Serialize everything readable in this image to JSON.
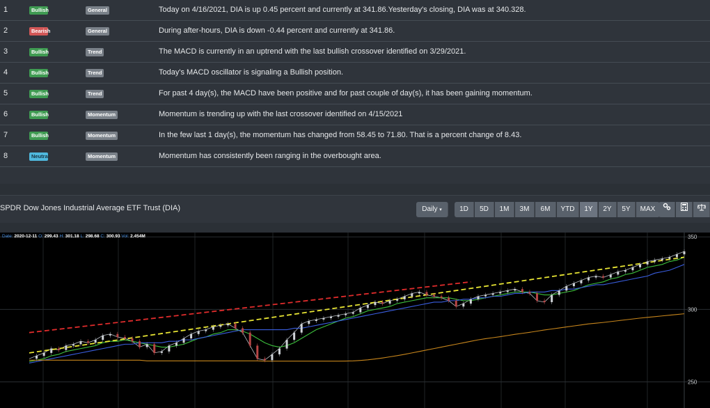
{
  "signals": [
    {
      "num": "1",
      "sentiment": "Bullish",
      "sentiment_kind": "pos",
      "category": "General",
      "text": "Today on 4/16/2021, DIA is up 0.45 percent and currently at 341.86.Yesterday's closing, DIA was at 340.328."
    },
    {
      "num": "2",
      "sentiment": "Bearish",
      "sentiment_kind": "neg",
      "category": "General",
      "text": "During after-hours, DIA is down -0.44 percent and currently at 341.86."
    },
    {
      "num": "3",
      "sentiment": "Bullish",
      "sentiment_kind": "pos",
      "category": "Trend",
      "text": "The MACD is currently in an uptrend with the last bullish crossover identified on 3/29/2021."
    },
    {
      "num": "4",
      "sentiment": "Bullish",
      "sentiment_kind": "pos",
      "category": "Trend",
      "text": "Today's MACD oscillator is signaling a Bullish position."
    },
    {
      "num": "5",
      "sentiment": "Bullish",
      "sentiment_kind": "pos",
      "category": "Trend",
      "text": "For past 4 day(s), the MACD have been positive and for past couple of day(s), it has been gaining momentum."
    },
    {
      "num": "6",
      "sentiment": "Bullish",
      "sentiment_kind": "pos",
      "category": "Momentum",
      "text": "Momentum is trending up with the last crossover identified on 4/15/2021"
    },
    {
      "num": "7",
      "sentiment": "Bullish",
      "sentiment_kind": "pos",
      "category": "Momentum",
      "text": "In the few last 1 day(s), the momentum has changed from 58.45 to 71.80. That is a percent change of 8.43."
    },
    {
      "num": "8",
      "sentiment": "Neutral",
      "sentiment_kind": "neu",
      "category": "Momentum",
      "text": "Momentum has consistently been ranging in the overbought area."
    }
  ],
  "toolbar": {
    "title": "SPDR Dow Jones Industrial Average ETF Trust (DIA)",
    "interval": "Daily",
    "ranges": [
      "1D",
      "5D",
      "1M",
      "3M",
      "6M",
      "YTD",
      "1Y",
      "2Y",
      "5Y",
      "MAX"
    ],
    "active_range": "1Y",
    "tool_icons": [
      "indicators-icon",
      "calculator-icon",
      "compare-icon"
    ]
  },
  "ohlc": {
    "date_label": "Date:",
    "date": "2020-12-11",
    "o_label": "O:",
    "o": "299.43",
    "h_label": "H:",
    "h": "301.18",
    "l_label": "L:",
    "l": "298.68",
    "c_label": "C:",
    "c": "300.93",
    "v_label": "Vol:",
    "v": "2.454M"
  },
  "chart_data": {
    "type": "line",
    "y_ticks": [
      250,
      300,
      350
    ],
    "ylim": [
      232,
      353
    ],
    "series": [
      {
        "kind": "close",
        "color": "#b9bec4",
        "values": [
          266,
          268,
          270,
          273,
          272,
          275,
          276,
          278,
          277,
          279,
          282,
          283,
          281,
          280,
          278,
          274,
          276,
          270,
          271,
          275,
          277,
          280,
          283,
          285,
          286,
          288,
          289,
          290,
          287,
          284,
          275,
          266,
          265,
          269,
          273,
          279,
          284,
          290,
          292,
          293,
          294,
          295,
          296,
          297,
          298,
          301,
          303,
          305,
          304,
          306,
          307,
          309,
          311,
          312,
          310,
          309,
          308,
          306,
          302,
          304,
          307,
          309,
          310,
          311,
          312,
          313,
          314,
          312,
          311,
          306,
          305,
          310,
          313,
          316,
          318,
          320,
          322,
          323,
          322,
          324,
          326,
          327,
          329,
          331,
          333,
          334,
          335,
          336,
          338,
          340
        ]
      },
      {
        "kind": "sma-short",
        "color": "#3cbf3c",
        "values": [
          264,
          265,
          266,
          268,
          269,
          271,
          272,
          273,
          274,
          275,
          277,
          278,
          278,
          279,
          278,
          277,
          276,
          275,
          274,
          274,
          275,
          276,
          278,
          280,
          281,
          283,
          284,
          286,
          286,
          285,
          283,
          280,
          277,
          275,
          274,
          275,
          277,
          280,
          283,
          286,
          288,
          290,
          292,
          294,
          295,
          297,
          299,
          300,
          301,
          302,
          304,
          305,
          306,
          307,
          308,
          308,
          308,
          308,
          307,
          306,
          306,
          307,
          308,
          309,
          310,
          311,
          312,
          312,
          312,
          311,
          310,
          310,
          311,
          312,
          313,
          315,
          317,
          318,
          319,
          321,
          322,
          324,
          325,
          327,
          329,
          330,
          331,
          333,
          334,
          336
        ]
      },
      {
        "kind": "sma-mid",
        "color": "#3a5ee0",
        "values": [
          263,
          264,
          265,
          266,
          267,
          268,
          269,
          270,
          271,
          272,
          273,
          274,
          275,
          276,
          276,
          277,
          277,
          277,
          277,
          278,
          278,
          279,
          279,
          280,
          281,
          282,
          283,
          284,
          285,
          286,
          286,
          286,
          286,
          286,
          286,
          286,
          287,
          287,
          288,
          289,
          290,
          291,
          292,
          293,
          294,
          295,
          296,
          297,
          298,
          299,
          300,
          301,
          302,
          303,
          304,
          305,
          305,
          306,
          306,
          307,
          307,
          308,
          308,
          309,
          309,
          310,
          311,
          311,
          312,
          312,
          312,
          313,
          313,
          314,
          314,
          315,
          316,
          317,
          317,
          318,
          319,
          320,
          321,
          322,
          323,
          325,
          326,
          327,
          329,
          331
        ]
      },
      {
        "kind": "sma-long",
        "color": "#c8861c",
        "values": [
          265,
          265,
          265,
          265,
          265,
          265,
          265,
          265,
          265,
          265,
          265,
          265,
          265,
          265,
          265,
          265,
          264.5,
          264.5,
          264.5,
          264.5,
          264.5,
          264.5,
          264.5,
          264.5,
          264.5,
          264.5,
          264.5,
          264.5,
          264.5,
          264.5,
          264.5,
          264.5,
          264.3,
          264.3,
          264.3,
          264.3,
          264.3,
          264.3,
          264.3,
          264.3,
          264.3,
          264.3,
          264.3,
          264.4,
          264.5,
          264.8,
          265.2,
          265.8,
          266.5,
          267.3,
          268.1,
          269,
          270,
          271,
          272,
          273,
          274,
          275,
          276,
          277,
          278,
          279,
          279.8,
          280.5,
          281.2,
          282,
          282.8,
          283.5,
          284.2,
          285,
          285.8,
          286.5,
          287.2,
          287.9,
          288.6,
          289.3,
          290,
          290.5,
          291,
          291.6,
          292.2,
          292.8,
          293.4,
          294,
          294.5,
          295,
          295.5,
          296,
          296.5,
          297
        ]
      },
      {
        "kind": "trend-resistance",
        "color": "#e02c2c",
        "dashed": true,
        "points": [
          [
            0,
            284
          ],
          [
            60,
            319
          ]
        ]
      },
      {
        "kind": "trend-support",
        "color": "#e8e534",
        "dashed": true,
        "points": [
          [
            0,
            270
          ],
          [
            89,
            336
          ]
        ]
      }
    ]
  }
}
